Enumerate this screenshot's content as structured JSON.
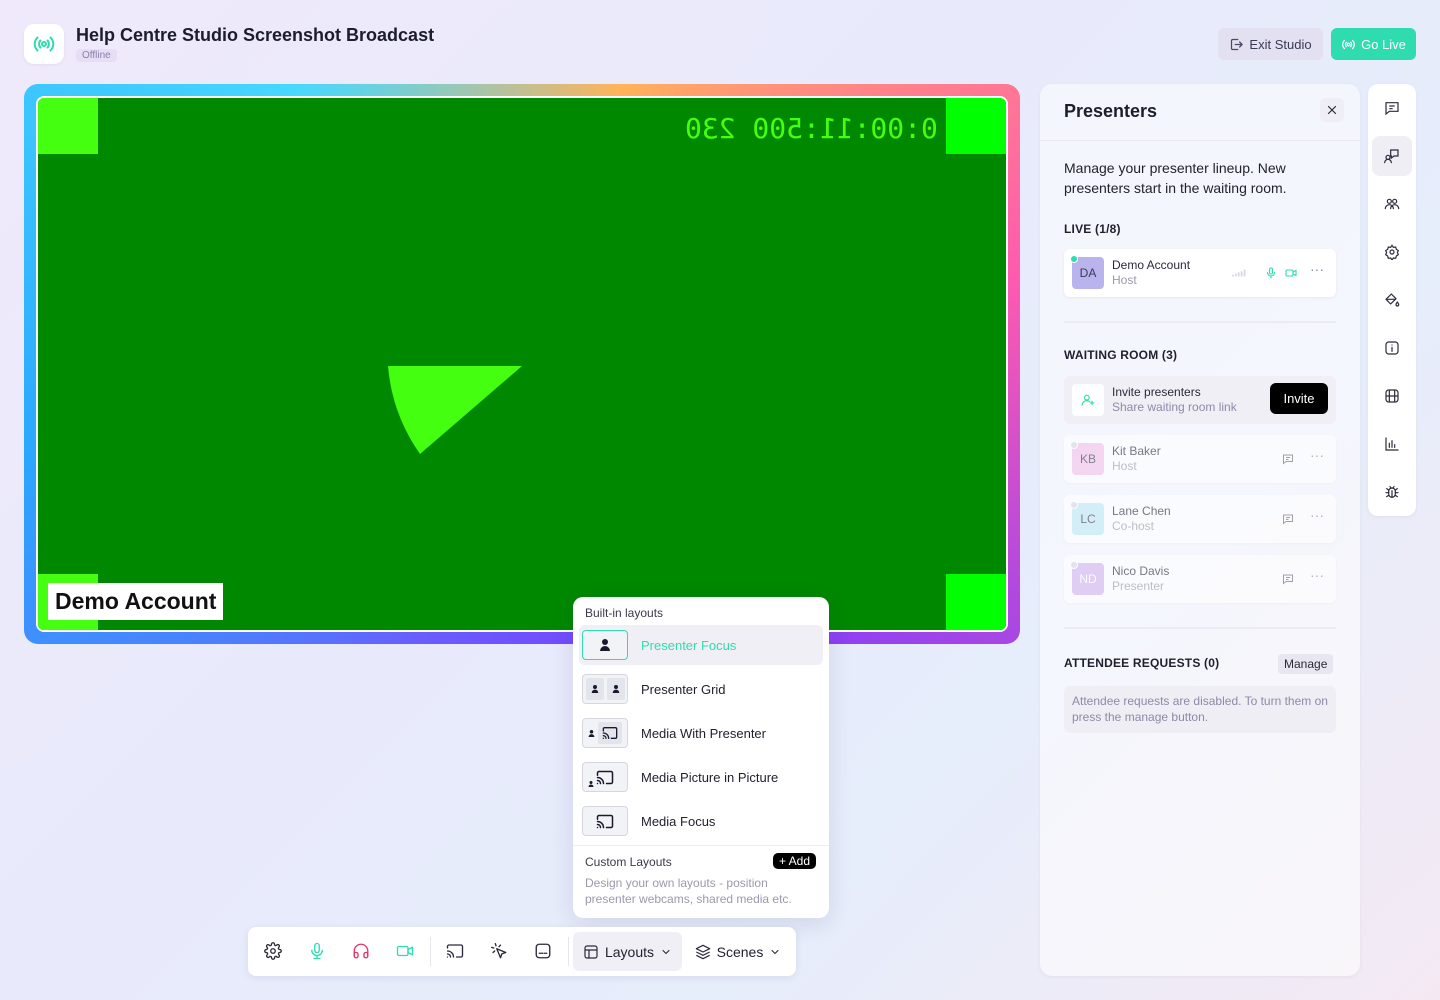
{
  "header": {
    "title": "Help Centre Studio Screenshot Broadcast",
    "status": "Offline",
    "exit_label": "Exit Studio",
    "golive_label": "Go Live"
  },
  "stage": {
    "timecode": "0:00:11:500 230",
    "name_tag": "Demo Account"
  },
  "layouts_menu": {
    "header": "Built-in layouts",
    "items": [
      {
        "label": "Presenter Focus",
        "active": true
      },
      {
        "label": "Presenter Grid",
        "active": false
      },
      {
        "label": "Media With Presenter",
        "active": false
      },
      {
        "label": "Media Picture in Picture",
        "active": false
      },
      {
        "label": "Media Focus",
        "active": false
      }
    ],
    "custom_title": "Custom Layouts",
    "add_label": "+ Add",
    "custom_desc": "Design your own layouts - position presenter webcams, shared media etc."
  },
  "toolbar": {
    "icons": [
      "settings-icon",
      "mic-icon",
      "headphones-icon",
      "camera-icon",
      "cast-icon",
      "pointer-icon",
      "captions-icon"
    ],
    "layouts_label": "Layouts",
    "scenes_label": "Scenes"
  },
  "presenters": {
    "title": "Presenters",
    "description": "Manage your presenter lineup. New presenters start in the waiting room.",
    "live_title": "LIVE (1/8)",
    "live": [
      {
        "initials": "DA",
        "name": "Demo Account",
        "role": "Host"
      }
    ],
    "waiting_title": "WAITING ROOM (3)",
    "invite_title": "Invite presenters",
    "invite_sub": "Share waiting room link",
    "invite_button": "Invite",
    "waiting": [
      {
        "initials": "KB",
        "name": "Kit Baker",
        "role": "Host"
      },
      {
        "initials": "LC",
        "name": "Lane Chen",
        "role": "Co-host"
      },
      {
        "initials": "ND",
        "name": "Nico Davis",
        "role": "Presenter"
      }
    ],
    "requests_title": "ATTENDEE REQUESTS (0)",
    "manage_label": "Manage",
    "requests_note": "Attendee requests are disabled. To turn them on press the manage button."
  },
  "colors": {
    "accent": "#2fdcb0",
    "stage_green": "#008800",
    "corner_green": "#00ff00",
    "mic_red": "#e8336b"
  },
  "rail": {
    "icons": [
      "chat-icon",
      "presenters-icon",
      "attendees-icon",
      "settings-icon",
      "brand-icon",
      "info-icon",
      "media-icon",
      "stats-icon",
      "bug-icon"
    ]
  }
}
